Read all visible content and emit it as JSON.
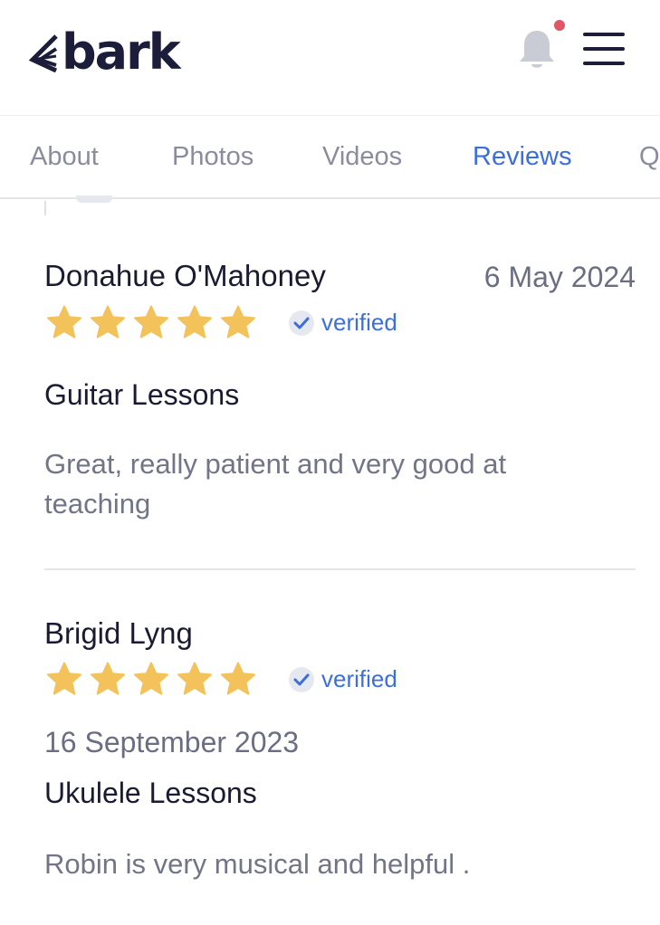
{
  "brand": {
    "logo_text": "bark",
    "color": "#1c1d3a",
    "notification_dot_color": "#e05667"
  },
  "header": {
    "notification_icon": "bell-icon",
    "menu_icon": "hamburger-menu-icon"
  },
  "tabs": [
    {
      "label": "About",
      "active": false
    },
    {
      "label": "Photos",
      "active": false
    },
    {
      "label": "Videos",
      "active": false
    },
    {
      "label": "Reviews",
      "active": true
    },
    {
      "label": "Q",
      "active": false
    }
  ],
  "accent_color": "#3c6fd9",
  "star_color": "#f3c25a",
  "reviews": [
    {
      "reviewer": "Donahue O'Mahoney",
      "date": "6 May 2024",
      "rating": 5,
      "verified_label": "verified",
      "service": "Guitar Lessons",
      "text": "Great, really patient and very good at teaching"
    },
    {
      "reviewer": "Brigid Lyng",
      "date": "16 September 2023",
      "rating": 5,
      "verified_label": "verified",
      "service": "Ukulele Lessons",
      "text": "Robin is very musical and helpful ."
    }
  ]
}
